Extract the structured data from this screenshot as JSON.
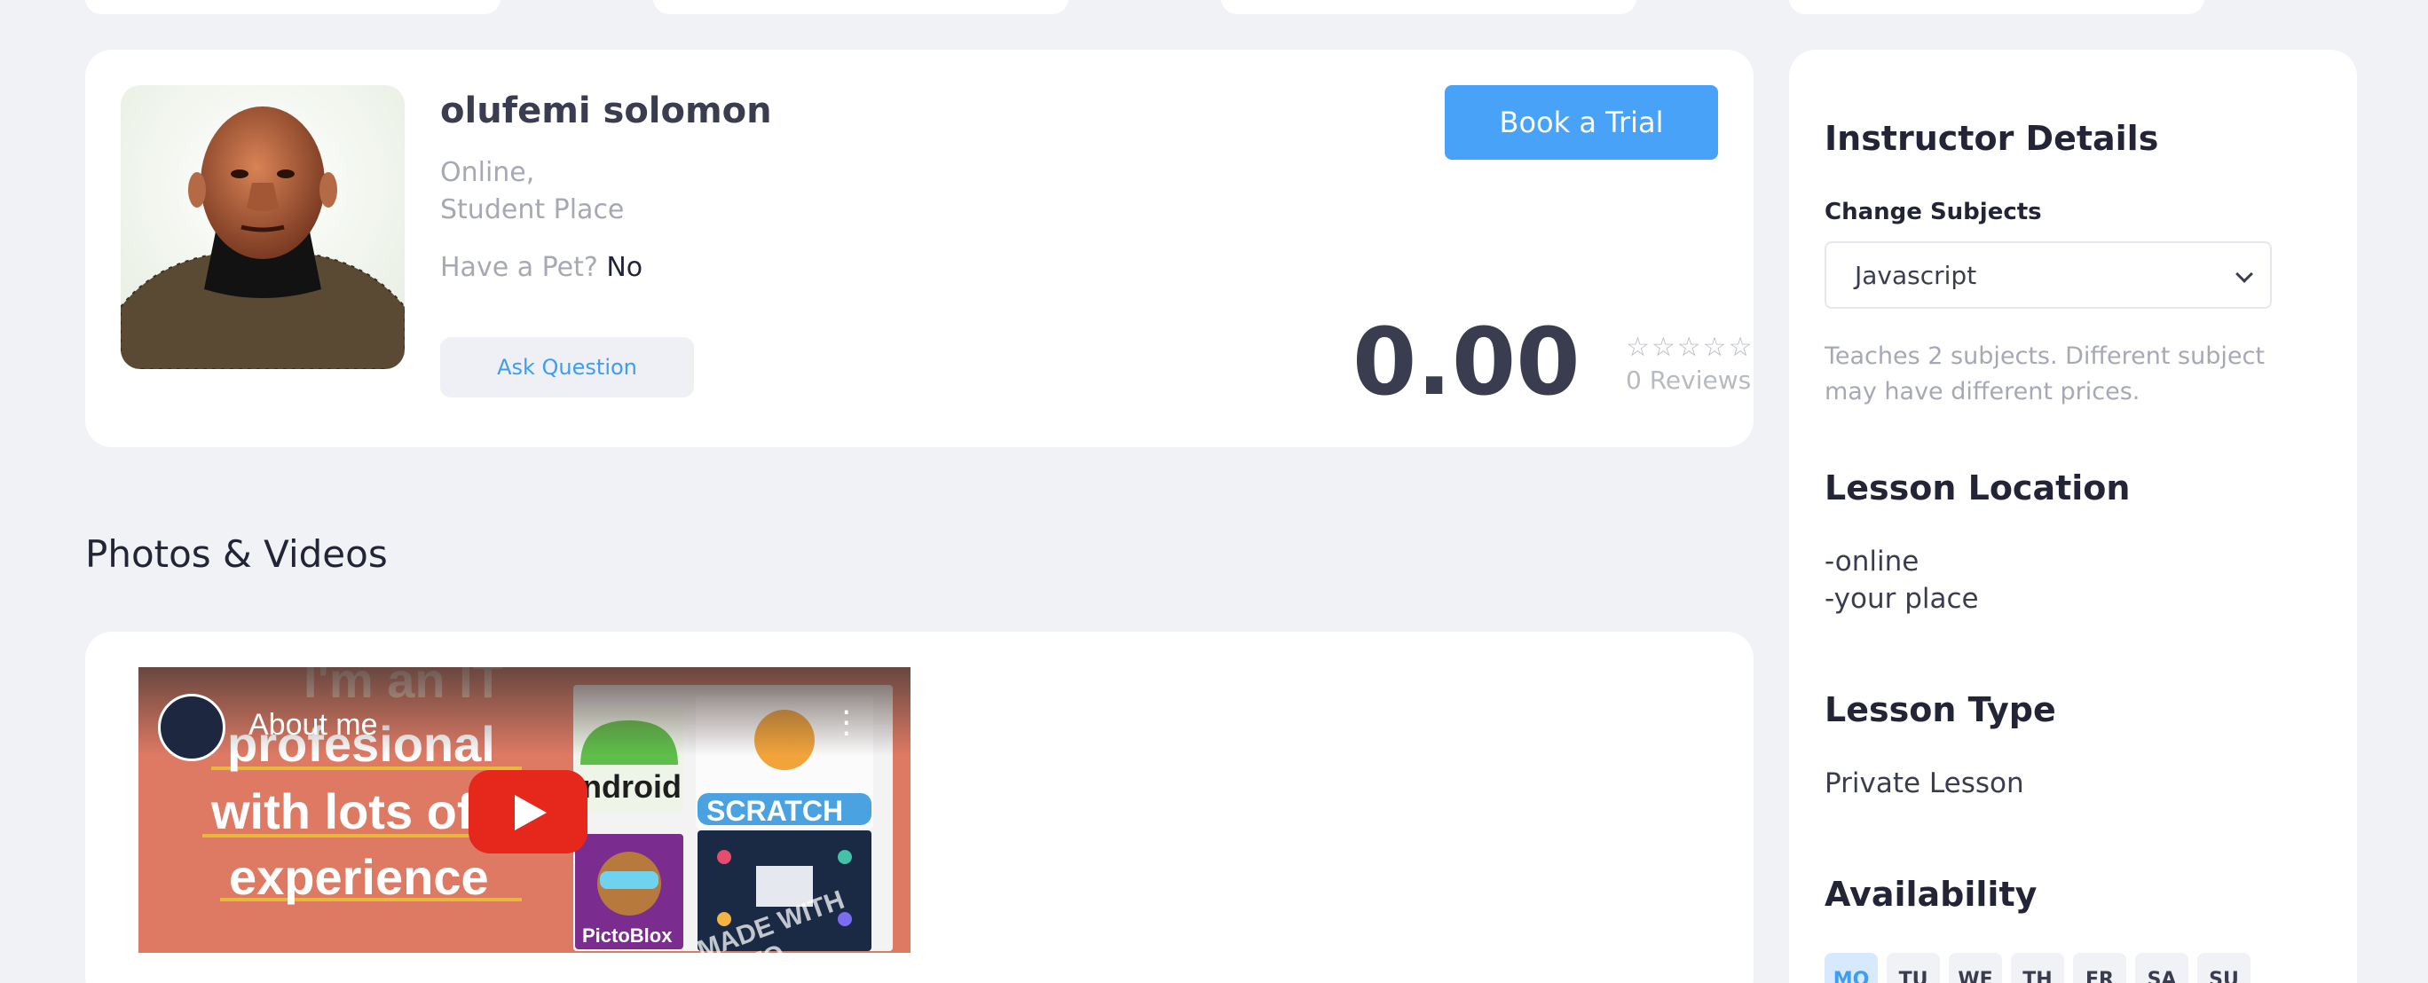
{
  "profile": {
    "name": "olufemi solomon",
    "locations": [
      "Online,",
      "Student Place"
    ],
    "pet_label": "Have a Pet?",
    "pet_value": "No",
    "ask_button": "Ask Question",
    "trial_button": "Book a Trial",
    "rating": "0.00",
    "stars": "☆☆☆☆☆",
    "reviews": "0 Reviews"
  },
  "media": {
    "section_title": "Photos & Videos",
    "video_title": "About me"
  },
  "sidebar": {
    "title": "Instructor Details",
    "change_subjects_label": "Change Subjects",
    "selected_subject": "Javascript",
    "subjects_note": "Teaches 2 subjects. Different subject may have different prices.",
    "location_title": "Lesson Location",
    "locations": [
      "-online",
      "-your place"
    ],
    "type_title": "Lesson Type",
    "lesson_type": "Private Lesson",
    "availability_title": "Availability",
    "days": [
      "MO",
      "TU",
      "WE",
      "TH",
      "FR",
      "SA",
      "SU"
    ],
    "active_day": "MO"
  },
  "colors": {
    "accent": "#48a2f8",
    "background": "#f1f2f6",
    "play_red": "#e6271b"
  }
}
